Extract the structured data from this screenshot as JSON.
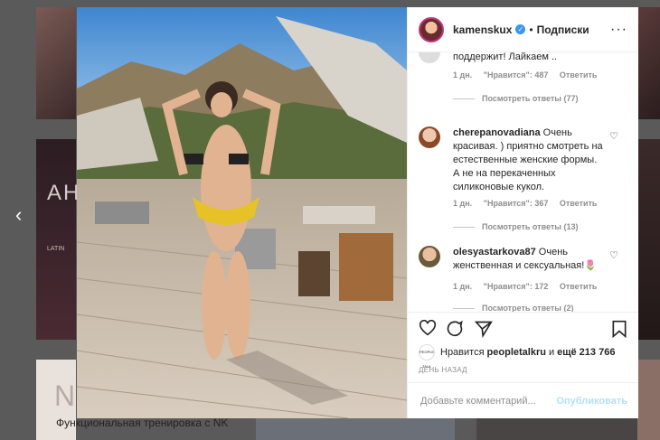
{
  "background": {
    "tile_text_1": "AH",
    "tile_text_2": "LATIN",
    "tile_text_3": "N",
    "promo_text": "Функциональная тренировка с NK"
  },
  "nav": {
    "prev_icon": "chevron-left-icon",
    "prev_glyph": "‹"
  },
  "post": {
    "username": "kamenskux",
    "verified_glyph": "✓",
    "separator": "•",
    "follow_label": "Подписки",
    "more_glyph": "···"
  },
  "comments": [
    {
      "text": "поддержит! Лайкаем ..",
      "time": "1 дн.",
      "likes": "\"Нравится\": 487",
      "reply": "Ответить",
      "view_replies": "Посмотреть ответы (77)"
    },
    {
      "username": "cherepanovadiana",
      "text": "Очень красивая. ) приятно смотреть на естественные женские формы. А не на перекаченных силиконовые кукол.",
      "time": "1 дн.",
      "likes": "\"Нравится\": 367",
      "reply": "Ответить",
      "view_replies": "Посмотреть ответы (13)"
    },
    {
      "username": "olesyastarkova87",
      "text": "Очень женственная и сексуальная!🌷",
      "time": "1 дн.",
      "likes": "\"Нравится\": 172",
      "reply": "Ответить",
      "view_replies": "Посмотреть ответы (2)"
    }
  ],
  "actions": {
    "like_icon": "heart-icon",
    "comment_icon": "comment-icon",
    "share_icon": "send-icon",
    "save_icon": "bookmark-icon"
  },
  "likes": {
    "avatar_text": "PEOPLE TALK",
    "prefix": "Нравится",
    "user": "peopletalkru",
    "middle": "и",
    "count": "ещё 213 766"
  },
  "date": "ДЕНЬ НАЗАД",
  "add_comment": {
    "placeholder": "Добавьте комментарий...",
    "post_label": "Опубликовать"
  },
  "colors": {
    "accent": "#3897f0",
    "post_disabled": "#b2dffc",
    "text": "#262626",
    "muted": "#8e8e8e"
  }
}
